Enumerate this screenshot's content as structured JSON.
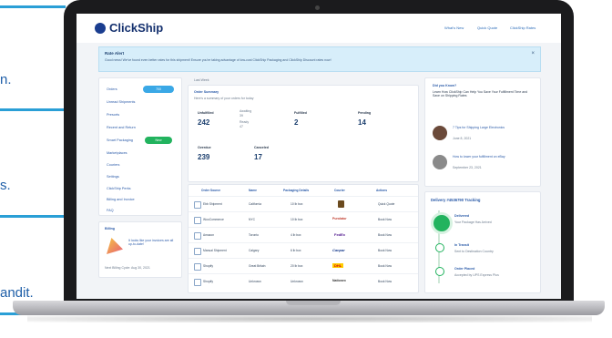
{
  "left_fragments": [
    "n.",
    "s.",
    "andit."
  ],
  "colors": {
    "brand": "#14306e",
    "accent": "#2a9fd6",
    "green": "#22b35e",
    "alert_bg": "#d7eefa"
  },
  "app": {
    "logo": "ClickShip",
    "nav": [
      "What's New",
      "Quick Quote",
      "ClickShip Rates"
    ],
    "alert": {
      "title": "Rate Alert",
      "body": "Good news! We've found even better rates for this shipment! Ensure you're taking advantage of low-cost ClickShip Packaging and ClickShip Discount rates now!",
      "close": "×"
    },
    "sidebar": {
      "items": [
        "Orders",
        "Unread Shipments",
        "Presorts",
        "Recent and Return",
        "Smart Packaging",
        "Marketplaces",
        "Couriers",
        "Settings",
        "ClickShip Perks",
        "Billing and Invoice",
        "FAQ"
      ],
      "orders_badge": "700",
      "packaging_badge": "New"
    },
    "billing": {
      "title": "Billing",
      "text": "It looks like your invoices are all up-to-date!",
      "footer": "Next Billing Cycle: Aug 30, 2021"
    },
    "summary": {
      "filter": "Last Week",
      "title": "Order Summary",
      "subtitle": "Here's a summary of your orders for today",
      "stats": [
        {
          "label": "Unfulfilled",
          "value": "242"
        },
        {
          "label": "Fulfilled",
          "value": "2"
        },
        {
          "label": "Pending",
          "value": "14"
        },
        {
          "label": "Overdue",
          "value": "239"
        },
        {
          "label": "Canceled",
          "value": "17"
        }
      ],
      "mini": {
        "a_label": "Awaiting",
        "a_value": "39",
        "b_label": "Ready",
        "b_value": "47"
      }
    },
    "table": {
      "headers": [
        "Order Source",
        "Name",
        "Packaging Details",
        "Courier",
        "Actions"
      ],
      "rows": [
        {
          "source": "Ebb Shipment",
          "name": "California",
          "pack": "10 lb box",
          "courier": "",
          "action": "Quick Quote"
        },
        {
          "source": "WooCommerce",
          "name": "NYC",
          "pack": "10 lb box",
          "courier": "Purolator",
          "action": "Book Now"
        },
        {
          "source": "Amazon",
          "name": "Toronto",
          "pack": "4 lb box",
          "courier": "FedEx",
          "action": "Book Now"
        },
        {
          "source": "Manual Shipment",
          "name": "Calgary",
          "pack": "6 lb box",
          "courier": "Canpar",
          "action": "Book Now"
        },
        {
          "source": "Shopify",
          "name": "Great Britain",
          "pack": "20 lb box",
          "courier": "DHL",
          "action": "Book Now"
        },
        {
          "source": "Shopify",
          "name": "Unknown",
          "pack": "Unknown",
          "courier": "Nationex",
          "action": "Book Now"
        }
      ]
    },
    "news": {
      "title": "Did you Know?",
      "text": "Learn How ClickShip Can Help You Save Your Fulfillment Time and Save on Shipping Rates",
      "items": [
        {
          "title": "7 Tips for Shipping Large Electronics",
          "date": "June 8, 2021"
        },
        {
          "title": "How to lower your fulfillment on eBay",
          "date": "September 23, 2021"
        }
      ]
    },
    "tracking": {
      "title": "Delivery #4536790 Tracking",
      "steps": [
        {
          "title": "Delivered",
          "text": "Your Package Has Arrived"
        },
        {
          "title": "In Transit",
          "text": "Sent to Destination Country"
        },
        {
          "title": "Order Placed",
          "text": "Accepted by UPS Express Plus"
        }
      ]
    }
  }
}
